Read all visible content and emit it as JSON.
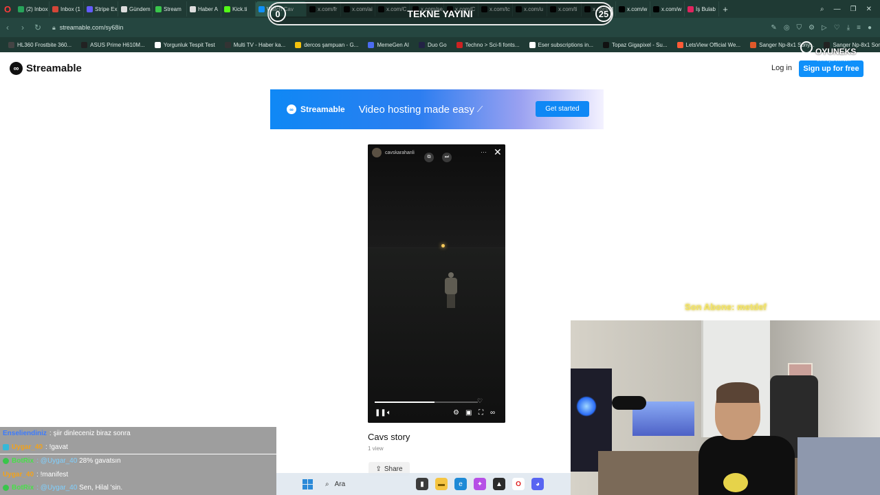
{
  "browser": {
    "tabs": [
      {
        "label": "(2) Inbox",
        "color": "#27a35a"
      },
      {
        "label": "Inbox (1",
        "color": "#d44638"
      },
      {
        "label": "Stripe Ex",
        "color": "#635bff"
      },
      {
        "label": "Gündem",
        "color": "#dddddd"
      },
      {
        "label": "Stream",
        "color": "#39c64b"
      },
      {
        "label": "Haber A",
        "color": "#dddddd"
      },
      {
        "label": "Kick.ti",
        "color": "#53fc18"
      },
      {
        "label": "Watch Cav",
        "color": "#0f90fa",
        "active": true
      },
      {
        "label": "x.com/fr",
        "color": "#000000"
      },
      {
        "label": "x.com/ai",
        "color": "#000000"
      },
      {
        "label": "x.com/C",
        "color": "#000000"
      },
      {
        "label": "x.com/se",
        "color": "#000000"
      },
      {
        "label": "x.com/C",
        "color": "#000000"
      },
      {
        "label": "x.com/tc",
        "color": "#000000"
      },
      {
        "label": "x.com/u",
        "color": "#000000"
      },
      {
        "label": "x.com/ti",
        "color": "#000000"
      },
      {
        "label": "x.com/M",
        "color": "#000000"
      },
      {
        "label": "x.com/w",
        "color": "#000000"
      },
      {
        "label": "x.com/w",
        "color": "#000000"
      },
      {
        "label": "İş Bulab",
        "color": "#e0245e"
      }
    ],
    "url": "streamable.com/sy68in",
    "bookmarks": [
      {
        "label": "HL360 Frostbite 360...",
        "color": "#444444"
      },
      {
        "label": "ASUS Prime H610M...",
        "color": "#222222"
      },
      {
        "label": "Yorgunluk Tespit Test",
        "color": "#ffffff"
      },
      {
        "label": "Multi TV - Haber ka...",
        "color": "#333333"
      },
      {
        "label": "dercos şampuan - G...",
        "color": "#f4c20d"
      },
      {
        "label": "MemeGen AI",
        "color": "#4b6cf0"
      },
      {
        "label": "Duo Go",
        "color": "#222244"
      },
      {
        "label": "Techno > Sci-fi fonts...",
        "color": "#cc2222"
      },
      {
        "label": "Eser subscriptions in...",
        "color": "#ffffff"
      },
      {
        "label": "Topaz Gigapixel - Su...",
        "color": "#111111"
      },
      {
        "label": "LetsView Official We...",
        "color": "#ff5a36"
      },
      {
        "label": "Sanger Np-8x1 Sony...",
        "color": "#e0592a"
      },
      {
        "label": "Sanger Np-8x1 Son...",
        "color": "#222222"
      }
    ]
  },
  "site": {
    "logo_mark": "∞",
    "logo_text": "Streamable",
    "login": "Log in",
    "signup": "Sign up for free"
  },
  "banner": {
    "brand": "Streamable",
    "slogan": "Video hosting made easy",
    "cta": "Get started"
  },
  "player": {
    "username": "cavskarahanli",
    "progress_fraction": 0.58,
    "state": "playing"
  },
  "video": {
    "title": "Cavs story",
    "views": "1 view",
    "share": "Share"
  },
  "overlay": {
    "title": "TEKNE YAYINI",
    "score_left": "0",
    "score_right": "25",
    "oyun_name": "OYUNEKS",
    "oyun_url": "www.oyuneks.com",
    "subscriber_label": "Son Abone: metdef"
  },
  "chat": [
    {
      "user": "Enseliendiniz",
      "user_color": "#3b7bff",
      "badge": "none",
      "message": ": şiir dinleceniz biraz sonra",
      "mention": ""
    },
    {
      "user": "Uygar_40",
      "user_color": "#f2a21b",
      "badge": "cyan",
      "message": ": !gavat",
      "mention": ""
    },
    {
      "user": "BotRix",
      "user_color": "#48e04a",
      "badge": "green",
      "message": " 28% gavatsın",
      "mention": ": @Uygar_40"
    },
    {
      "user": "Uygar_40",
      "user_color": "#f2a21b",
      "badge": "none",
      "message": ": !manifest",
      "mention": ""
    },
    {
      "user": "BotRix",
      "user_color": "#48e04a",
      "badge": "green",
      "message": " Sen, Hilal 'sin.",
      "mention": ": @Uygar_40"
    }
  ],
  "taskbar": {
    "search_label": "Ara"
  }
}
